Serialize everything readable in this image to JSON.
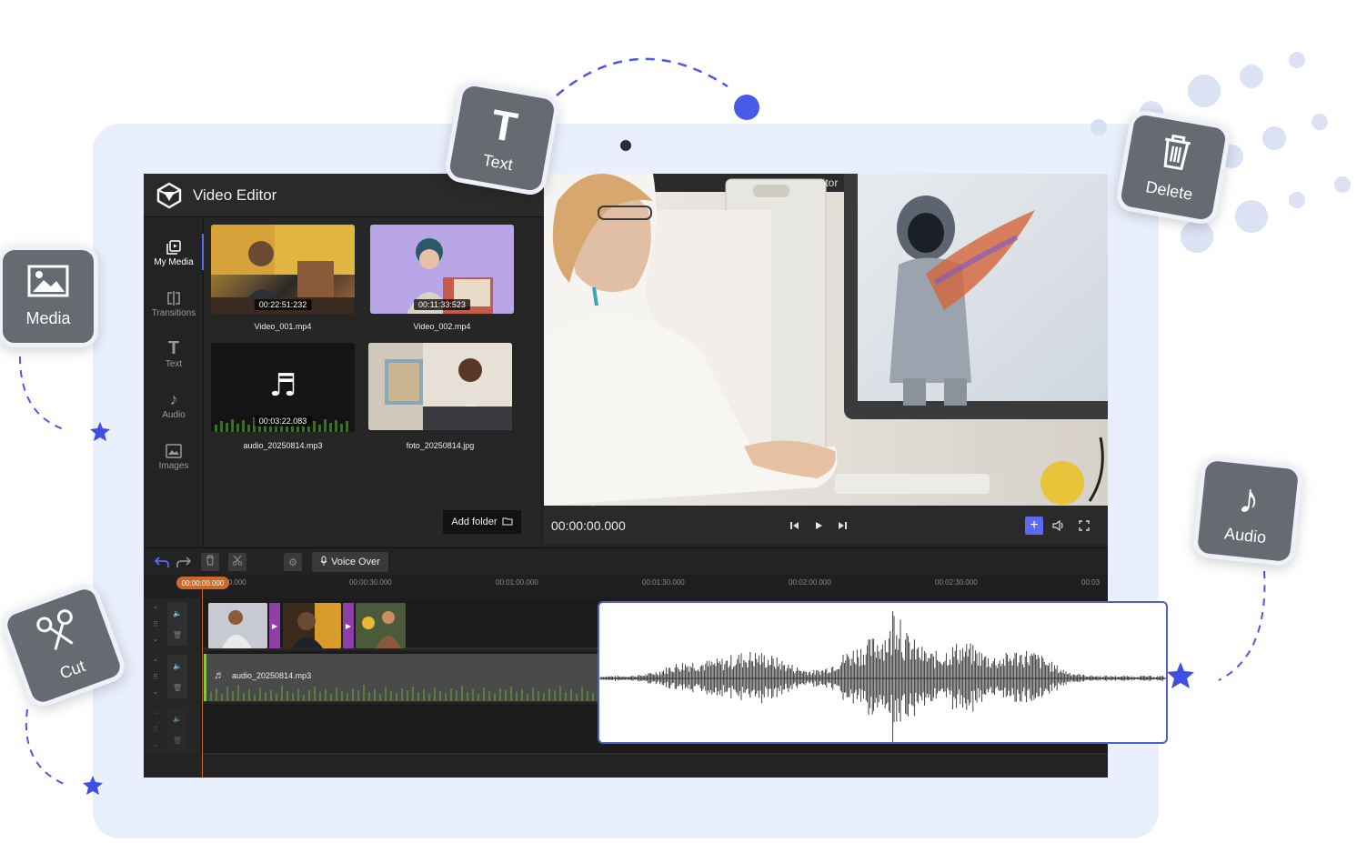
{
  "app": {
    "title": "Video Editor",
    "title_partial_behind": "ditor"
  },
  "nav": [
    {
      "label": "My Media",
      "icon": "media-library-icon",
      "active": true
    },
    {
      "label": "Transitions",
      "icon": "transitions-icon",
      "active": false
    },
    {
      "label": "Text",
      "icon": "text-icon",
      "active": false
    },
    {
      "label": "Audio",
      "icon": "music-note-icon",
      "active": false
    },
    {
      "label": "Images",
      "icon": "image-icon",
      "active": false
    }
  ],
  "media": [
    {
      "name": "Video_001.mp4",
      "duration": "00:22:51:232",
      "kind": "video"
    },
    {
      "name": "Video_002.mp4",
      "duration": "00:11:33:523",
      "kind": "video"
    },
    {
      "name": "audio_20250814.mp3",
      "duration": "00:03:22.083",
      "kind": "audio"
    },
    {
      "name": "foto_20250814.jpg",
      "kind": "image"
    }
  ],
  "add_folder_label": "Add folder",
  "player": {
    "time": "00:00:00.000"
  },
  "toolbar": {
    "voice_over_label": "Voice Over"
  },
  "timeline": {
    "playhead": "00:00:00.000",
    "ticks": [
      "00:00:00.000",
      "00:00:30.000",
      "00:01:00.000",
      "00:01:30.000",
      "00:02:00.000",
      "00:02:30.000",
      "00:03"
    ],
    "audio_clip_label": "audio_20250814.mp3"
  },
  "floating_badges": [
    {
      "label": "Text",
      "icon": "text-icon"
    },
    {
      "label": "Delete",
      "icon": "trash-icon"
    },
    {
      "label": "Media",
      "icon": "image-icon"
    },
    {
      "label": "Audio",
      "icon": "music-note-icon"
    },
    {
      "label": "Cut",
      "icon": "scissors-icon"
    }
  ],
  "colors": {
    "accent": "#5b6af0",
    "background_panel": "#e9effc",
    "app_bg": "#232323",
    "badge_bg": "#666b72",
    "playhead": "#c86a2e",
    "transition": "#8e3fa8",
    "audio_wave_green": "#7ec94a"
  }
}
